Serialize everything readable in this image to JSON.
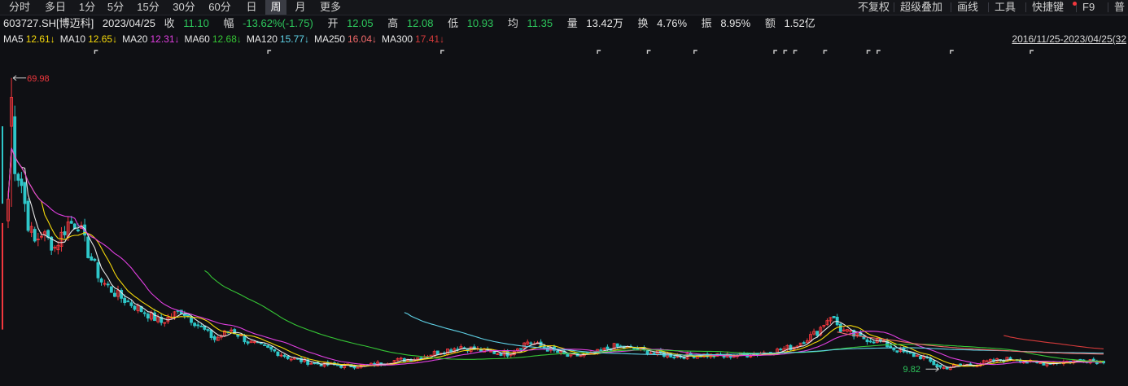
{
  "toolbar": {
    "periods": [
      {
        "label": "分时"
      },
      {
        "label": "多日"
      },
      {
        "label": "1分"
      },
      {
        "label": "5分"
      },
      {
        "label": "15分"
      },
      {
        "label": "30分"
      },
      {
        "label": "60分"
      },
      {
        "label": "日"
      },
      {
        "label": "周"
      },
      {
        "label": "月"
      },
      {
        "label": "更多"
      }
    ],
    "active_period": "周",
    "right_items": [
      {
        "label": "不复权"
      },
      {
        "label": "超级叠加"
      },
      {
        "label": "画线"
      },
      {
        "label": "工具"
      },
      {
        "label": "快捷键"
      },
      {
        "label": "F9"
      },
      {
        "label": "普"
      }
    ]
  },
  "quote": {
    "symbol": "603727.SH[博迈科]",
    "date": "2023/04/25",
    "close_label": "收",
    "close": "11.10",
    "change_label": "幅",
    "change": "-13.62%(-1.75)",
    "open_label": "开",
    "open": "12.05",
    "high_label": "高",
    "high": "12.08",
    "low_label": "低",
    "low": "10.93",
    "avg_label": "均",
    "avg": "11.35",
    "volume_label": "量",
    "volume": "13.42万",
    "turnover_label": "换",
    "turnover": "4.76%",
    "amplitude_label": "振",
    "amplitude": "8.95%",
    "amount_label": "额",
    "amount": "1.52亿"
  },
  "ma_legend": [
    {
      "name": "MA5",
      "value": "12.61↓",
      "color": "#e8e8e8",
      "value_color": "#f5d90a"
    },
    {
      "name": "MA10",
      "value": "12.65↓",
      "color": "#e8e8e8",
      "value_color": "#f5d90a"
    },
    {
      "name": "MA20",
      "value": "12.31↓",
      "color": "#e8e8e8",
      "value_color": "#e03fe0"
    },
    {
      "name": "MA60",
      "value": "12.68↓",
      "color": "#e8e8e8",
      "value_color": "#35c535"
    },
    {
      "name": "MA120",
      "value": "15.77↓",
      "color": "#e8e8e8",
      "value_color": "#5fd3e8"
    },
    {
      "name": "MA250",
      "value": "16.04↓",
      "color": "#e8e8e8",
      "value_color": "#f26a6a"
    },
    {
      "name": "MA300",
      "value": "17.41↓",
      "color": "#e8e8e8",
      "value_color": "#d43a3a"
    }
  ],
  "range_label": "2016/11/25-2023/04/25(32",
  "chart_data": {
    "type": "candlestick",
    "ylim": [
      7,
      76
    ],
    "high_marker": "69.98",
    "low_marker": "9.82",
    "high_marker_value": 69.98,
    "low_marker_value": 9.82,
    "n_bars": 330,
    "anchors": [
      [
        0,
        45
      ],
      [
        1,
        62
      ],
      [
        2,
        52
      ],
      [
        4,
        48
      ],
      [
        6,
        40
      ],
      [
        8,
        36
      ],
      [
        10,
        38
      ],
      [
        14,
        35
      ],
      [
        18,
        40
      ],
      [
        21,
        40
      ],
      [
        24,
        34
      ],
      [
        28,
        28
      ],
      [
        33,
        25
      ],
      [
        40,
        22
      ],
      [
        46,
        19.5
      ],
      [
        52,
        22
      ],
      [
        57,
        19
      ],
      [
        62,
        16
      ],
      [
        67,
        18
      ],
      [
        72,
        15.5
      ],
      [
        80,
        13.5
      ],
      [
        85,
        12
      ],
      [
        92,
        11
      ],
      [
        100,
        10.5
      ],
      [
        108,
        10.5
      ],
      [
        115,
        11.5
      ],
      [
        122,
        12
      ],
      [
        130,
        13.5
      ],
      [
        136,
        14.5
      ],
      [
        143,
        13.5
      ],
      [
        150,
        13
      ],
      [
        156,
        15.5
      ],
      [
        162,
        14
      ],
      [
        168,
        12.5
      ],
      [
        175,
        12.8
      ],
      [
        182,
        14.5
      ],
      [
        188,
        14
      ],
      [
        195,
        13
      ],
      [
        202,
        12.5
      ],
      [
        208,
        12.8
      ],
      [
        214,
        12.5
      ],
      [
        222,
        12.8
      ],
      [
        230,
        13.5
      ],
      [
        236,
        14.5
      ],
      [
        243,
        17.5
      ],
      [
        247,
        21
      ],
      [
        250,
        18
      ],
      [
        255,
        16.5
      ],
      [
        262,
        15.5
      ],
      [
        266,
        14
      ],
      [
        270,
        13
      ],
      [
        275,
        12.2
      ],
      [
        280,
        10
      ],
      [
        285,
        10.5
      ],
      [
        290,
        10.8
      ],
      [
        296,
        11.5
      ],
      [
        302,
        12
      ],
      [
        308,
        11
      ],
      [
        314,
        11.2
      ],
      [
        320,
        11.5
      ],
      [
        325,
        11.8
      ],
      [
        329,
        11.1
      ]
    ],
    "time_marker_bars": [
      26,
      78,
      130,
      177,
      192,
      206,
      230,
      233,
      236,
      245,
      258,
      261,
      283,
      307
    ],
    "ma_series": [
      {
        "name": "MA5",
        "color": "#e8e8e8",
        "period": 5,
        "start": 0
      },
      {
        "name": "MA10",
        "color": "#f5d90a",
        "period": 10,
        "start": 0
      },
      {
        "name": "MA20",
        "color": "#e03fe0",
        "period": 20,
        "start": 0
      },
      {
        "name": "MA60",
        "color": "#35c535",
        "period": 60,
        "start": 59
      },
      {
        "name": "MA120",
        "color": "#5fd3e8",
        "period": 120,
        "start": 119
      },
      {
        "name": "MA250",
        "color": "#f26a6a",
        "period": 250,
        "start": 249
      },
      {
        "name": "MA300",
        "color": "#d43a3a",
        "period": 300,
        "start": 299
      }
    ],
    "up_color": "#f2373d",
    "down_color": "#2ec7c9"
  }
}
